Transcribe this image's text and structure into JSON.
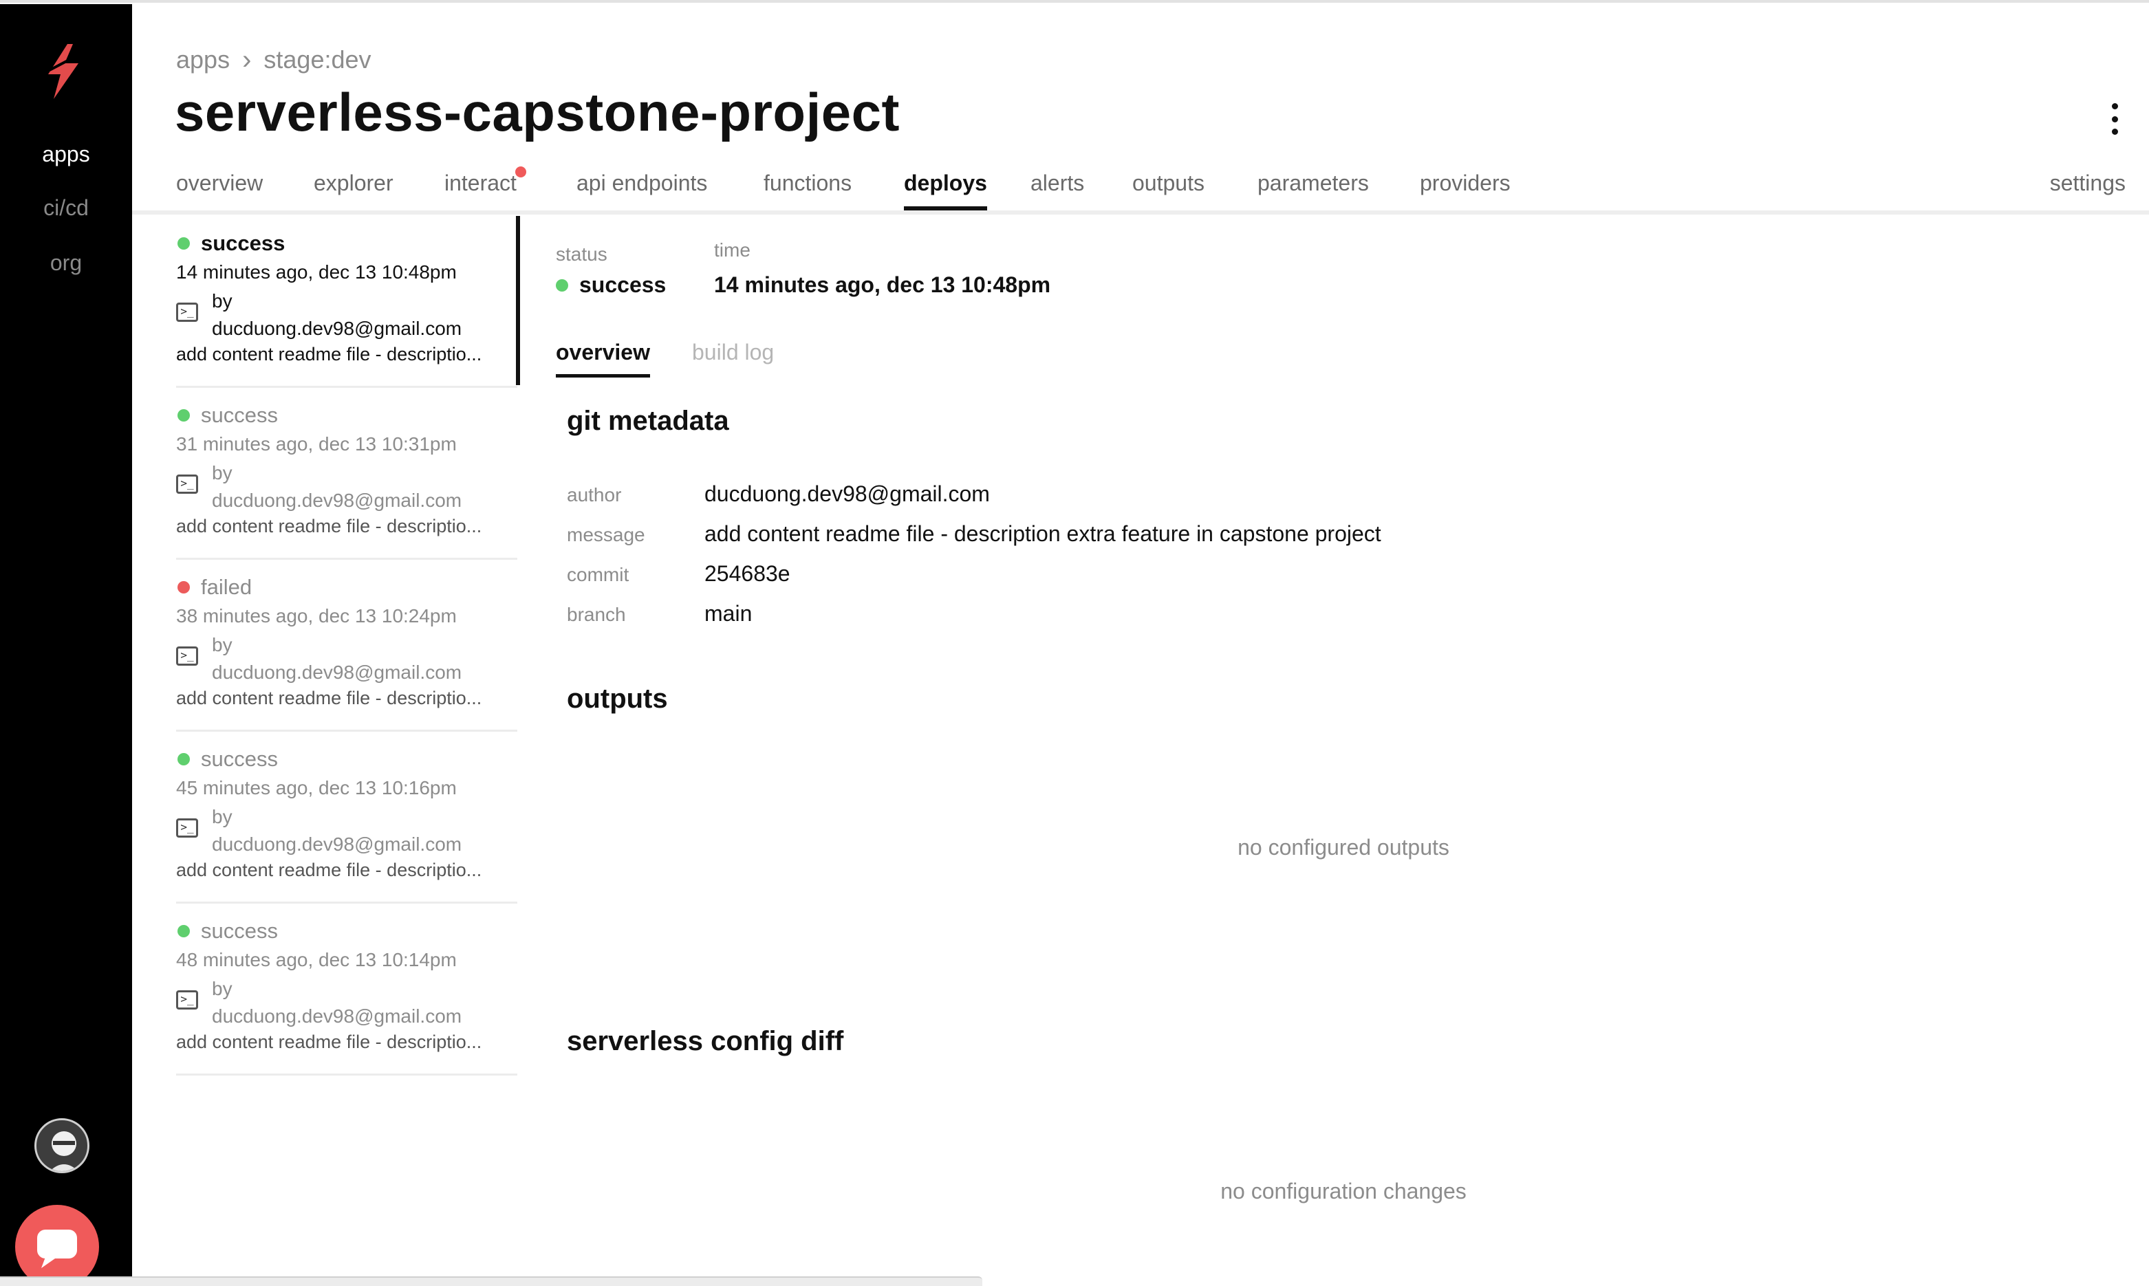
{
  "rail": {
    "items": [
      {
        "label": "apps",
        "active": true
      },
      {
        "label": "ci/cd",
        "active": false
      },
      {
        "label": "org",
        "active": false
      }
    ],
    "brand_color": "#f05a5a"
  },
  "header": {
    "breadcrumb": [
      "apps",
      "stage:dev"
    ],
    "title": "serverless-capstone-project",
    "settings_label": "settings"
  },
  "tabs": [
    {
      "label": "overview",
      "active": false
    },
    {
      "label": "explorer",
      "active": false
    },
    {
      "label": "interact",
      "active": false,
      "notification": true
    },
    {
      "label": "api endpoints",
      "active": false
    },
    {
      "label": "functions",
      "active": false
    },
    {
      "label": "deploys",
      "active": true
    },
    {
      "label": "alerts",
      "active": false
    },
    {
      "label": "outputs",
      "active": false
    },
    {
      "label": "parameters",
      "active": false
    },
    {
      "label": "providers",
      "active": false
    }
  ],
  "deploys": [
    {
      "status": "success",
      "when": "14 minutes ago, dec 13 10:48pm",
      "by_label": "by",
      "author": "ducduong.dev98@gmail.com",
      "message": "add content readme file - descriptio...",
      "selected": true
    },
    {
      "status": "success",
      "when": "31 minutes ago, dec 13 10:31pm",
      "by_label": "by",
      "author": "ducduong.dev98@gmail.com",
      "message": "add content readme file - descriptio...",
      "selected": false
    },
    {
      "status": "failed",
      "when": "38 minutes ago, dec 13 10:24pm",
      "by_label": "by",
      "author": "ducduong.dev98@gmail.com",
      "message": "add content readme file - descriptio...",
      "selected": false
    },
    {
      "status": "success",
      "when": "45 minutes ago, dec 13 10:16pm",
      "by_label": "by",
      "author": "ducduong.dev98@gmail.com",
      "message": "add content readme file - descriptio...",
      "selected": false
    },
    {
      "status": "success",
      "when": "48 minutes ago, dec 13 10:14pm",
      "by_label": "by",
      "author": "ducduong.dev98@gmail.com",
      "message": "add content readme file - descriptio...",
      "selected": false
    }
  ],
  "detail": {
    "status_label": "status",
    "status_value": "success",
    "time_label": "time",
    "time_value": "14 minutes ago, dec 13 10:48pm",
    "subtabs": [
      {
        "label": "overview",
        "active": true
      },
      {
        "label": "build log",
        "active": false
      }
    ],
    "git_heading": "git metadata",
    "git": [
      {
        "key": "author",
        "value": "ducduong.dev98@gmail.com"
      },
      {
        "key": "message",
        "value": "add content readme file - description extra feature in capstone project"
      },
      {
        "key": "commit",
        "value": "254683e"
      },
      {
        "key": "branch",
        "value": "main"
      }
    ],
    "outputs_heading": "outputs",
    "outputs_empty": "no configured outputs",
    "diff_heading": "serverless config diff",
    "diff_empty": "no configuration changes"
  },
  "colors": {
    "success": "#5fcf6e",
    "failed": "#ec5b5b",
    "notification": "#f05a5a"
  }
}
